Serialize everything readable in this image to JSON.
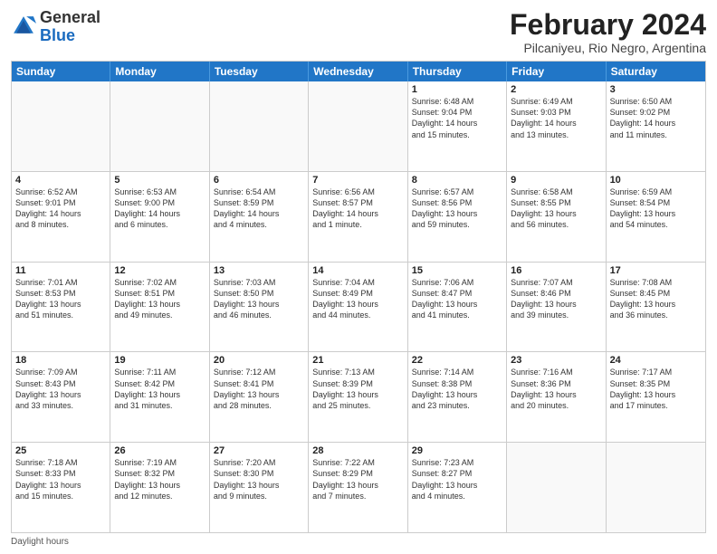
{
  "header": {
    "logo_general": "General",
    "logo_blue": "Blue",
    "month_title": "February 2024",
    "location": "Pilcaniyeu, Rio Negro, Argentina"
  },
  "calendar": {
    "days_of_week": [
      "Sunday",
      "Monday",
      "Tuesday",
      "Wednesday",
      "Thursday",
      "Friday",
      "Saturday"
    ],
    "weeks": [
      [
        {
          "day": "",
          "empty": true
        },
        {
          "day": "",
          "empty": true
        },
        {
          "day": "",
          "empty": true
        },
        {
          "day": "",
          "empty": true
        },
        {
          "day": "1",
          "lines": [
            "Sunrise: 6:48 AM",
            "Sunset: 9:04 PM",
            "Daylight: 14 hours",
            "and 15 minutes."
          ]
        },
        {
          "day": "2",
          "lines": [
            "Sunrise: 6:49 AM",
            "Sunset: 9:03 PM",
            "Daylight: 14 hours",
            "and 13 minutes."
          ]
        },
        {
          "day": "3",
          "lines": [
            "Sunrise: 6:50 AM",
            "Sunset: 9:02 PM",
            "Daylight: 14 hours",
            "and 11 minutes."
          ]
        }
      ],
      [
        {
          "day": "4",
          "lines": [
            "Sunrise: 6:52 AM",
            "Sunset: 9:01 PM",
            "Daylight: 14 hours",
            "and 8 minutes."
          ]
        },
        {
          "day": "5",
          "lines": [
            "Sunrise: 6:53 AM",
            "Sunset: 9:00 PM",
            "Daylight: 14 hours",
            "and 6 minutes."
          ]
        },
        {
          "day": "6",
          "lines": [
            "Sunrise: 6:54 AM",
            "Sunset: 8:59 PM",
            "Daylight: 14 hours",
            "and 4 minutes."
          ]
        },
        {
          "day": "7",
          "lines": [
            "Sunrise: 6:56 AM",
            "Sunset: 8:57 PM",
            "Daylight: 14 hours",
            "and 1 minute."
          ]
        },
        {
          "day": "8",
          "lines": [
            "Sunrise: 6:57 AM",
            "Sunset: 8:56 PM",
            "Daylight: 13 hours",
            "and 59 minutes."
          ]
        },
        {
          "day": "9",
          "lines": [
            "Sunrise: 6:58 AM",
            "Sunset: 8:55 PM",
            "Daylight: 13 hours",
            "and 56 minutes."
          ]
        },
        {
          "day": "10",
          "lines": [
            "Sunrise: 6:59 AM",
            "Sunset: 8:54 PM",
            "Daylight: 13 hours",
            "and 54 minutes."
          ]
        }
      ],
      [
        {
          "day": "11",
          "lines": [
            "Sunrise: 7:01 AM",
            "Sunset: 8:53 PM",
            "Daylight: 13 hours",
            "and 51 minutes."
          ]
        },
        {
          "day": "12",
          "lines": [
            "Sunrise: 7:02 AM",
            "Sunset: 8:51 PM",
            "Daylight: 13 hours",
            "and 49 minutes."
          ]
        },
        {
          "day": "13",
          "lines": [
            "Sunrise: 7:03 AM",
            "Sunset: 8:50 PM",
            "Daylight: 13 hours",
            "and 46 minutes."
          ]
        },
        {
          "day": "14",
          "lines": [
            "Sunrise: 7:04 AM",
            "Sunset: 8:49 PM",
            "Daylight: 13 hours",
            "and 44 minutes."
          ]
        },
        {
          "day": "15",
          "lines": [
            "Sunrise: 7:06 AM",
            "Sunset: 8:47 PM",
            "Daylight: 13 hours",
            "and 41 minutes."
          ]
        },
        {
          "day": "16",
          "lines": [
            "Sunrise: 7:07 AM",
            "Sunset: 8:46 PM",
            "Daylight: 13 hours",
            "and 39 minutes."
          ]
        },
        {
          "day": "17",
          "lines": [
            "Sunrise: 7:08 AM",
            "Sunset: 8:45 PM",
            "Daylight: 13 hours",
            "and 36 minutes."
          ]
        }
      ],
      [
        {
          "day": "18",
          "lines": [
            "Sunrise: 7:09 AM",
            "Sunset: 8:43 PM",
            "Daylight: 13 hours",
            "and 33 minutes."
          ]
        },
        {
          "day": "19",
          "lines": [
            "Sunrise: 7:11 AM",
            "Sunset: 8:42 PM",
            "Daylight: 13 hours",
            "and 31 minutes."
          ]
        },
        {
          "day": "20",
          "lines": [
            "Sunrise: 7:12 AM",
            "Sunset: 8:41 PM",
            "Daylight: 13 hours",
            "and 28 minutes."
          ]
        },
        {
          "day": "21",
          "lines": [
            "Sunrise: 7:13 AM",
            "Sunset: 8:39 PM",
            "Daylight: 13 hours",
            "and 25 minutes."
          ]
        },
        {
          "day": "22",
          "lines": [
            "Sunrise: 7:14 AM",
            "Sunset: 8:38 PM",
            "Daylight: 13 hours",
            "and 23 minutes."
          ]
        },
        {
          "day": "23",
          "lines": [
            "Sunrise: 7:16 AM",
            "Sunset: 8:36 PM",
            "Daylight: 13 hours",
            "and 20 minutes."
          ]
        },
        {
          "day": "24",
          "lines": [
            "Sunrise: 7:17 AM",
            "Sunset: 8:35 PM",
            "Daylight: 13 hours",
            "and 17 minutes."
          ]
        }
      ],
      [
        {
          "day": "25",
          "lines": [
            "Sunrise: 7:18 AM",
            "Sunset: 8:33 PM",
            "Daylight: 13 hours",
            "and 15 minutes."
          ]
        },
        {
          "day": "26",
          "lines": [
            "Sunrise: 7:19 AM",
            "Sunset: 8:32 PM",
            "Daylight: 13 hours",
            "and 12 minutes."
          ]
        },
        {
          "day": "27",
          "lines": [
            "Sunrise: 7:20 AM",
            "Sunset: 8:30 PM",
            "Daylight: 13 hours",
            "and 9 minutes."
          ]
        },
        {
          "day": "28",
          "lines": [
            "Sunrise: 7:22 AM",
            "Sunset: 8:29 PM",
            "Daylight: 13 hours",
            "and 7 minutes."
          ]
        },
        {
          "day": "29",
          "lines": [
            "Sunrise: 7:23 AM",
            "Sunset: 8:27 PM",
            "Daylight: 13 hours",
            "and 4 minutes."
          ]
        },
        {
          "day": "",
          "empty": true
        },
        {
          "day": "",
          "empty": true
        }
      ]
    ]
  },
  "footer": {
    "label": "Daylight hours"
  }
}
